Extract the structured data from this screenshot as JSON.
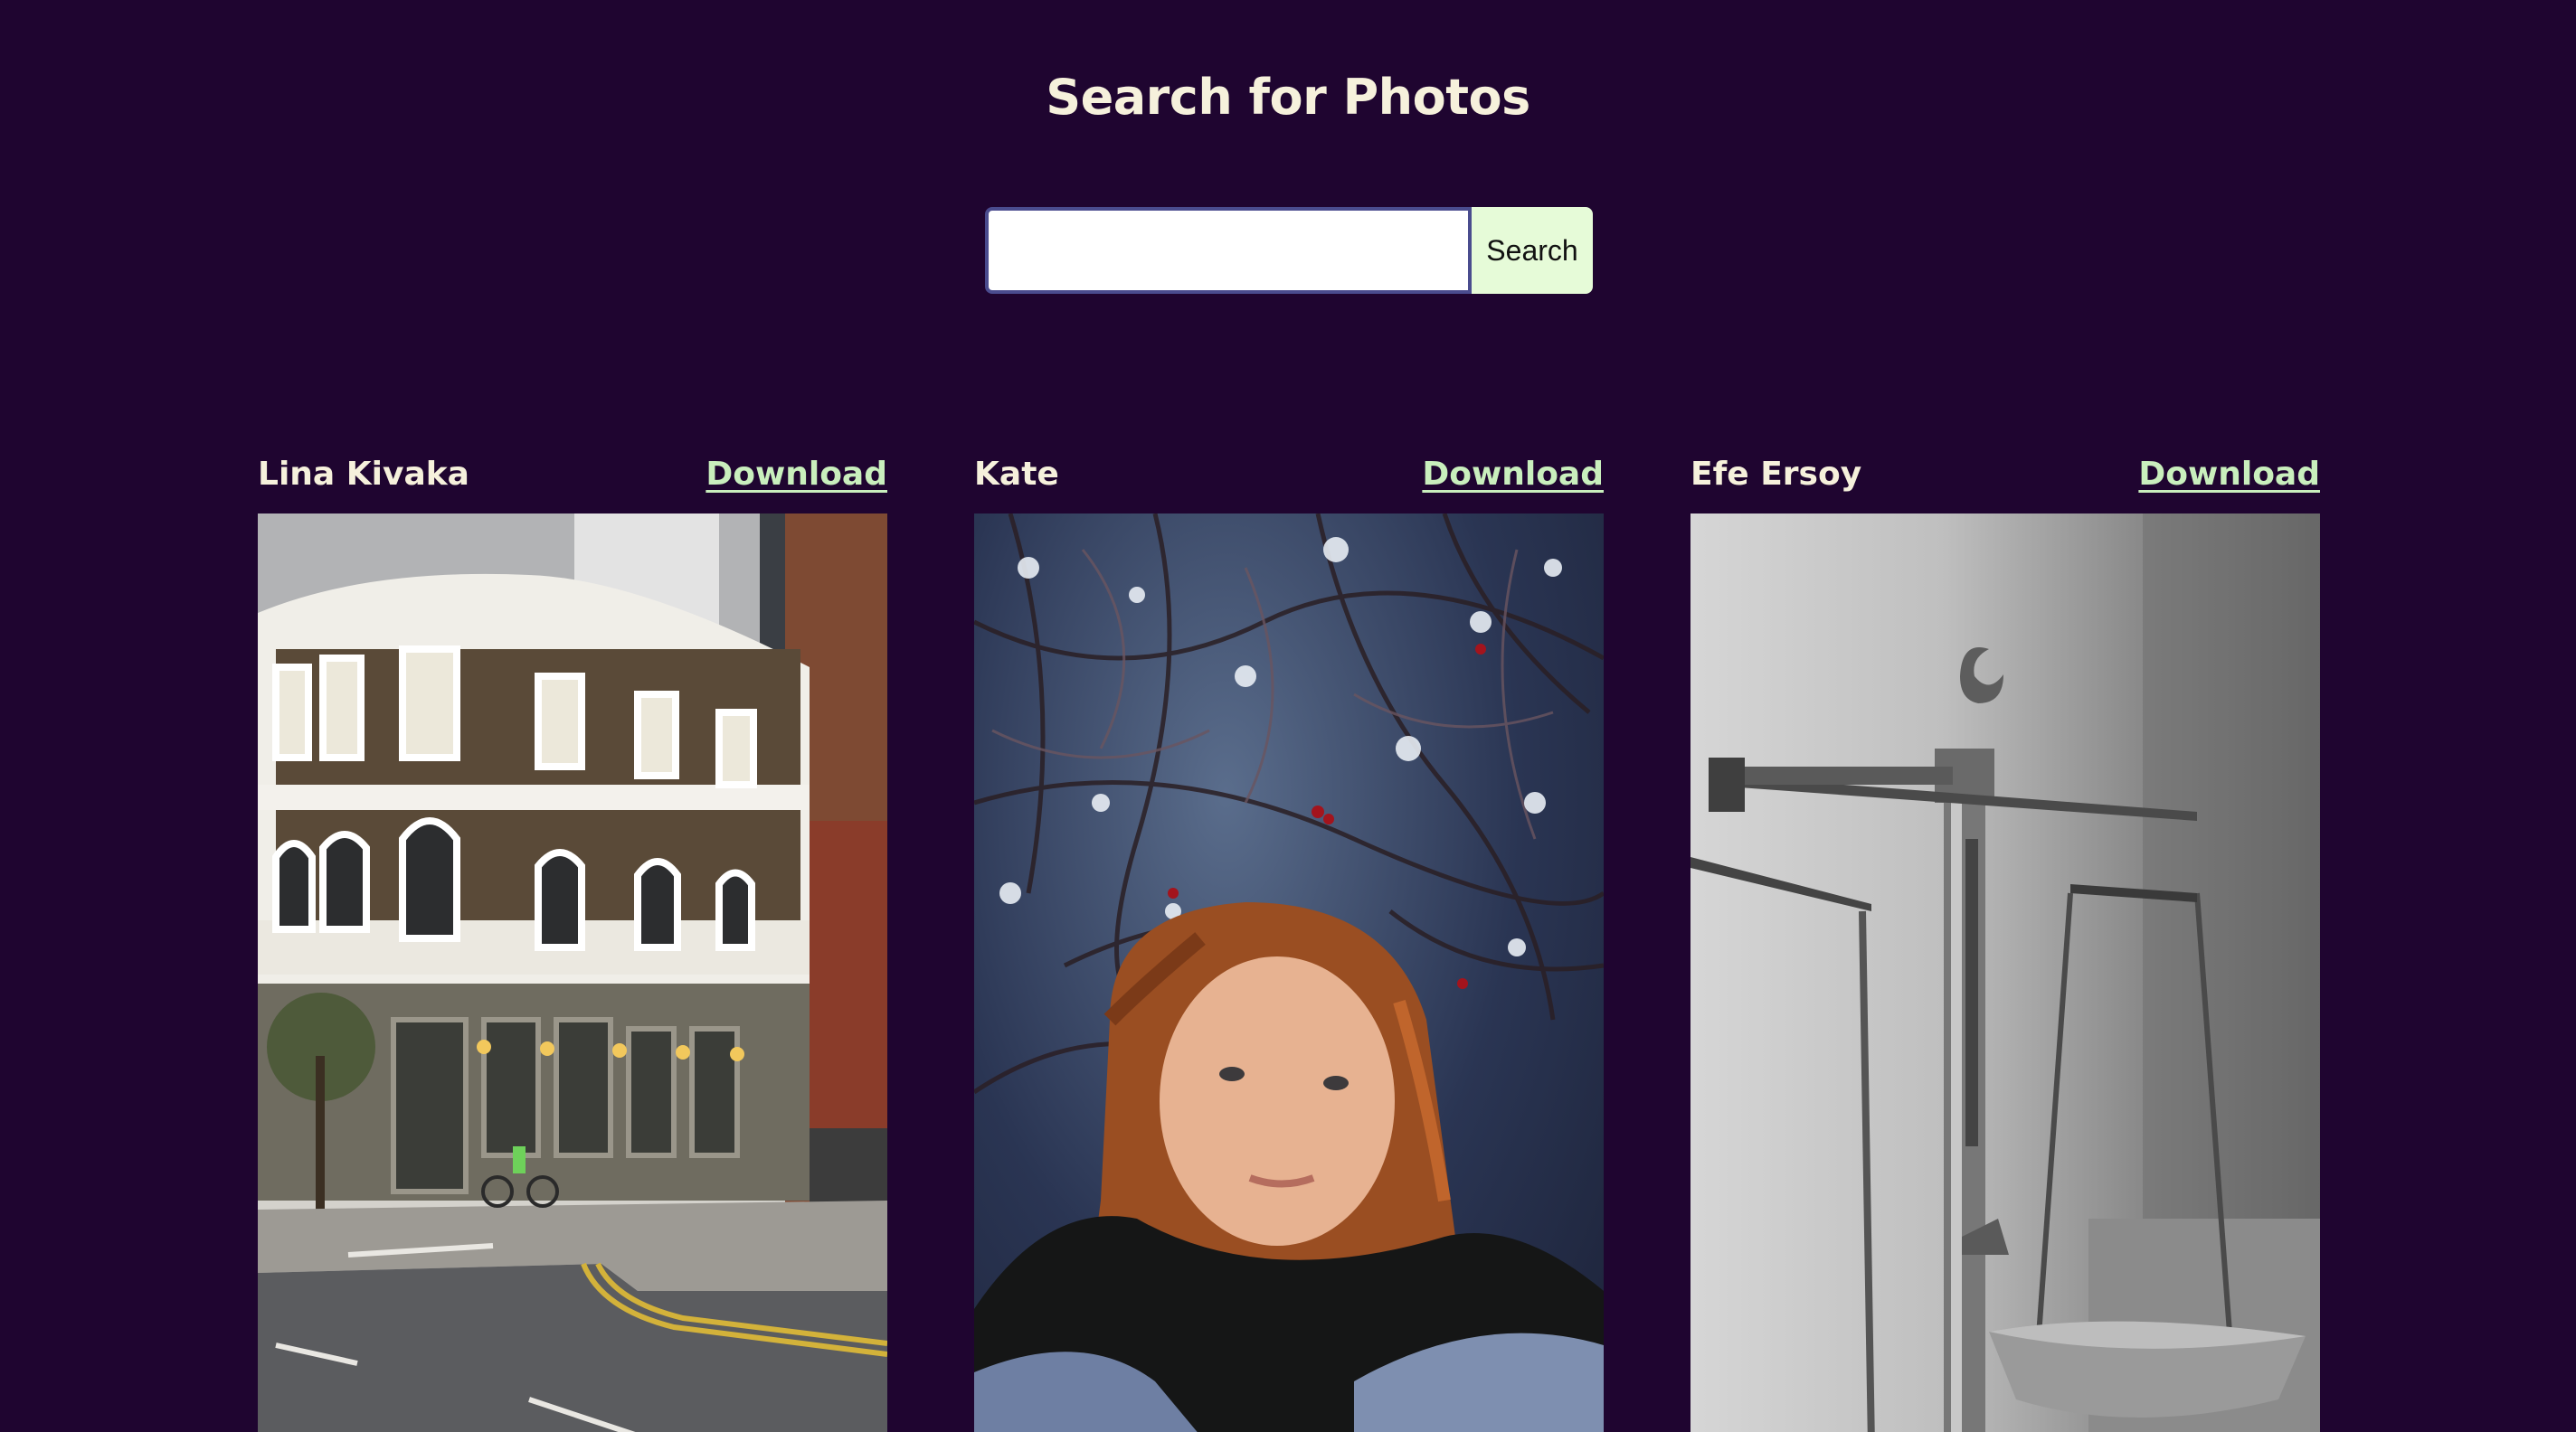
{
  "header": {
    "title": "Search for Photos"
  },
  "search": {
    "value": "",
    "placeholder": "",
    "button_label": "Search"
  },
  "results": [
    {
      "author": "Lina Kivaka",
      "download_label": "Download",
      "subject": "building"
    },
    {
      "author": "Kate",
      "download_label": "Download",
      "subject": "portrait"
    },
    {
      "author": "Efe Ersoy",
      "download_label": "Download",
      "subject": "scale"
    }
  ],
  "colors": {
    "background": "#1f0530",
    "title": "#f6f1dc",
    "download_link": "#c9efbd",
    "search_button_bg": "#e6fbd8",
    "search_input_border": "#4a4c8e"
  }
}
